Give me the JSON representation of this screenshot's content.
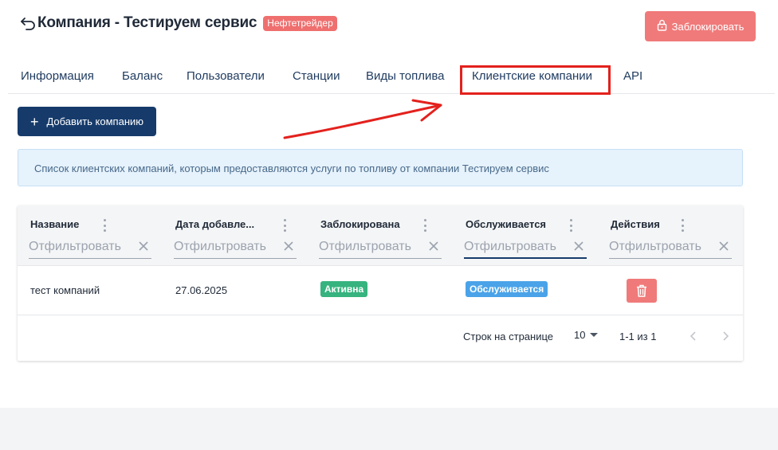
{
  "header": {
    "title": "Компания - Тестируем сервис",
    "badge": "Нефтетрейдер",
    "block_button": "Заблокировать"
  },
  "tabs": [
    {
      "label": "Информация"
    },
    {
      "label": "Баланс"
    },
    {
      "label": "Пользователи"
    },
    {
      "label": "Станции"
    },
    {
      "label": "Виды топлива"
    },
    {
      "label": "Клиентские компании"
    },
    {
      "label": "API"
    }
  ],
  "add_button": "Добавить компанию",
  "info_text": "Список клиентских компаний, которым предоставляются услуги по топливу от компании Тестируем сервис",
  "table": {
    "columns": [
      {
        "title": "Название",
        "filter_placeholder": "Отфильтровать"
      },
      {
        "title": "Дата добавле...",
        "filter_placeholder": "Отфильтровать"
      },
      {
        "title": "Заблокирована",
        "filter_placeholder": "Отфильтровать"
      },
      {
        "title": "Обслуживается",
        "filter_placeholder": "Отфильтровать"
      },
      {
        "title": "Действия",
        "filter_placeholder": "Отфильтровать"
      }
    ],
    "rows": [
      {
        "name": "тест компаний",
        "date": "27.06.2025",
        "blocked": "Активна",
        "served": "Обслуживается"
      }
    ],
    "footer": {
      "rows_per_page_label": "Строк на странице",
      "rows_per_page": "10",
      "range": "1-1 из 1"
    }
  },
  "colors": {
    "primary": "#163b6b",
    "danger": "#f07a7a",
    "success": "#36b37e",
    "info": "#4aa3e8",
    "annotation": "#e3211d"
  }
}
